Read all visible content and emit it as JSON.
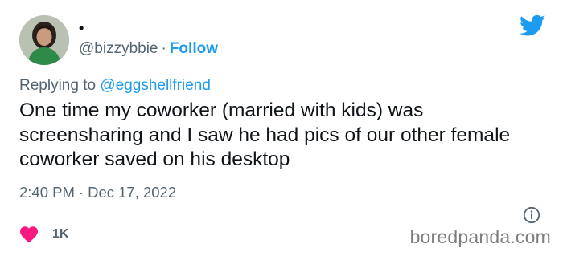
{
  "author": {
    "display_name": "•",
    "handle": "@bizzybbie",
    "separator": "·",
    "follow_label": "Follow"
  },
  "reply": {
    "prefix": "Replying to",
    "mention": "@eggshellfriend"
  },
  "tweet": {
    "text": "One time my coworker (married with kids) was screensharing and I saw he had pics of our other female coworker saved on his desktop"
  },
  "meta": {
    "time": "2:40 PM",
    "separator": "·",
    "date": "Dec 17, 2022"
  },
  "likes": {
    "count": "1K"
  },
  "watermark": {
    "text": "boredpanda.com"
  },
  "icons": {
    "logo": "twitter-bird-icon",
    "like": "heart-icon",
    "info": "info-icon"
  },
  "colors": {
    "accent": "#1d9bf0",
    "heart": "#f91880",
    "secondary_text": "#536471",
    "primary_text": "#0f1419"
  }
}
